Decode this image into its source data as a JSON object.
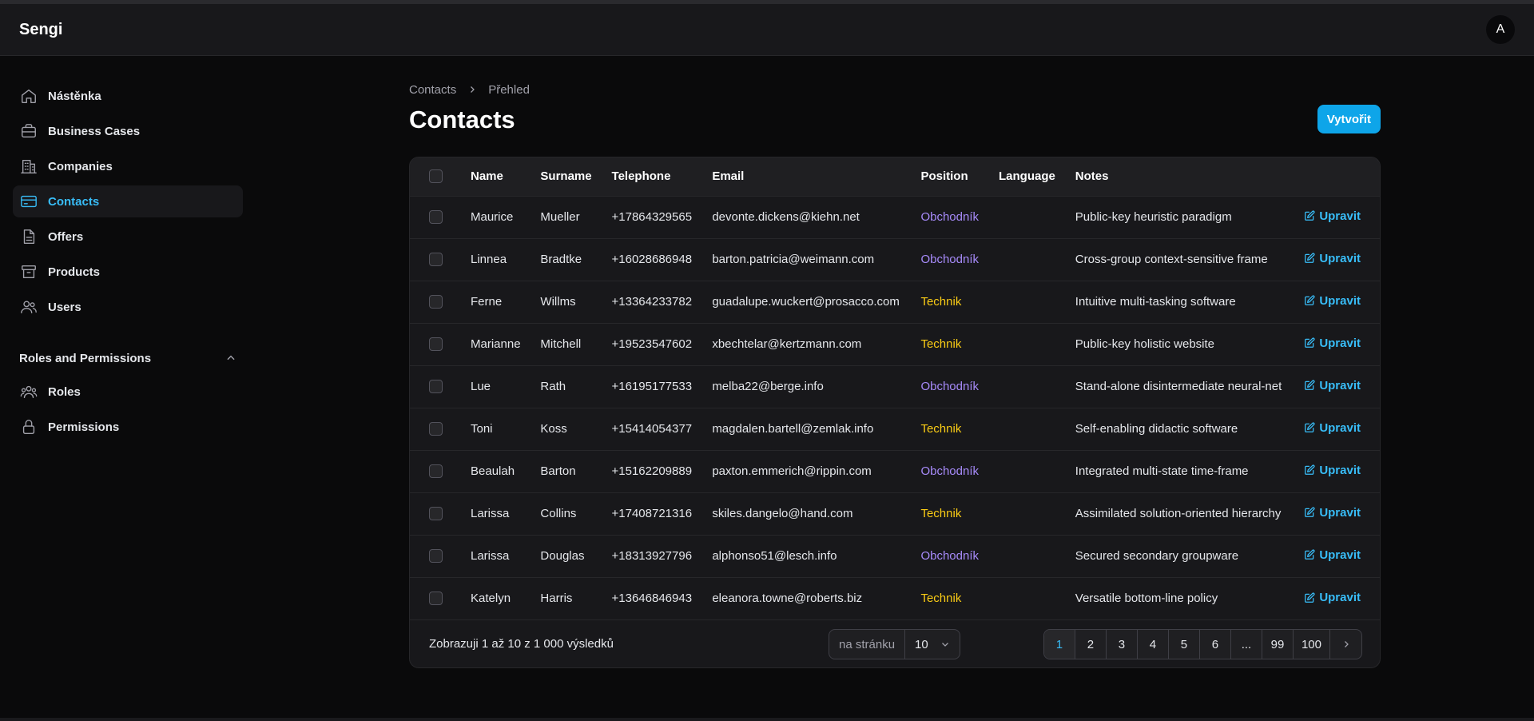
{
  "app": {
    "brand": "Sengi",
    "avatar_initial": "A"
  },
  "sidebar": {
    "items": [
      {
        "label": "Nástěnka",
        "icon": "home-icon"
      },
      {
        "label": "Business Cases",
        "icon": "briefcase-icon"
      },
      {
        "label": "Companies",
        "icon": "building-icon"
      },
      {
        "label": "Contacts",
        "icon": "credit-card-icon",
        "active": true
      },
      {
        "label": "Offers",
        "icon": "document-icon"
      },
      {
        "label": "Products",
        "icon": "archive-box-icon"
      },
      {
        "label": "Users",
        "icon": "users-icon"
      }
    ],
    "group": {
      "title": "Roles and Permissions",
      "items": [
        {
          "label": "Roles",
          "icon": "user-group-icon"
        },
        {
          "label": "Permissions",
          "icon": "lock-icon"
        }
      ]
    }
  },
  "breadcrumb": {
    "parent": "Contacts",
    "current": "Přehled"
  },
  "page": {
    "title": "Contacts",
    "create_label": "Vytvořit"
  },
  "table": {
    "columns": [
      "Name",
      "Surname",
      "Telephone",
      "Email",
      "Position",
      "Language",
      "Notes"
    ],
    "edit_label": "Upravit",
    "rows": [
      {
        "name": "Maurice",
        "surname": "Mueller",
        "telephone": "+17864329565",
        "email": "devonte.dickens@kiehn.net",
        "position": "Obchodník",
        "language": "",
        "notes": "Public-key heuristic paradigm"
      },
      {
        "name": "Linnea",
        "surname": "Bradtke",
        "telephone": "+16028686948",
        "email": "barton.patricia@weimann.com",
        "position": "Obchodník",
        "language": "",
        "notes": "Cross-group context-sensitive frame"
      },
      {
        "name": "Ferne",
        "surname": "Willms",
        "telephone": "+13364233782",
        "email": "guadalupe.wuckert@prosacco.com",
        "position": "Technik",
        "language": "",
        "notes": "Intuitive multi-tasking software"
      },
      {
        "name": "Marianne",
        "surname": "Mitchell",
        "telephone": "+19523547602",
        "email": "xbechtelar@kertzmann.com",
        "position": "Technik",
        "language": "",
        "notes": "Public-key holistic website"
      },
      {
        "name": "Lue",
        "surname": "Rath",
        "telephone": "+16195177533",
        "email": "melba22@berge.info",
        "position": "Obchodník",
        "language": "",
        "notes": "Stand-alone disintermediate neural-net"
      },
      {
        "name": "Toni",
        "surname": "Koss",
        "telephone": "+15414054377",
        "email": "magdalen.bartell@zemlak.info",
        "position": "Technik",
        "language": "",
        "notes": "Self-enabling didactic software"
      },
      {
        "name": "Beaulah",
        "surname": "Barton",
        "telephone": "+15162209889",
        "email": "paxton.emmerich@rippin.com",
        "position": "Obchodník",
        "language": "",
        "notes": "Integrated multi-state time-frame"
      },
      {
        "name": "Larissa",
        "surname": "Collins",
        "telephone": "+17408721316",
        "email": "skiles.dangelo@hand.com",
        "position": "Technik",
        "language": "",
        "notes": "Assimilated solution-oriented hierarchy"
      },
      {
        "name": "Larissa",
        "surname": "Douglas",
        "telephone": "+18313927796",
        "email": "alphonso51@lesch.info",
        "position": "Obchodník",
        "language": "",
        "notes": "Secured secondary groupware"
      },
      {
        "name": "Katelyn",
        "surname": "Harris",
        "telephone": "+13646846943",
        "email": "eleanora.towne@roberts.biz",
        "position": "Technik",
        "language": "",
        "notes": "Versatile bottom-line policy"
      }
    ]
  },
  "footer": {
    "results_text": "Zobrazuji 1 až 10 z 1 000 výsledků",
    "per_page_label": "na stránku",
    "per_page_value": "10",
    "pages": [
      "1",
      "2",
      "3",
      "4",
      "5",
      "6",
      "...",
      "99",
      "100"
    ],
    "current_page": "1"
  },
  "colors": {
    "accent": "#0ea5e9",
    "obchodnik": "#a78bfa",
    "technik": "#facc15"
  }
}
